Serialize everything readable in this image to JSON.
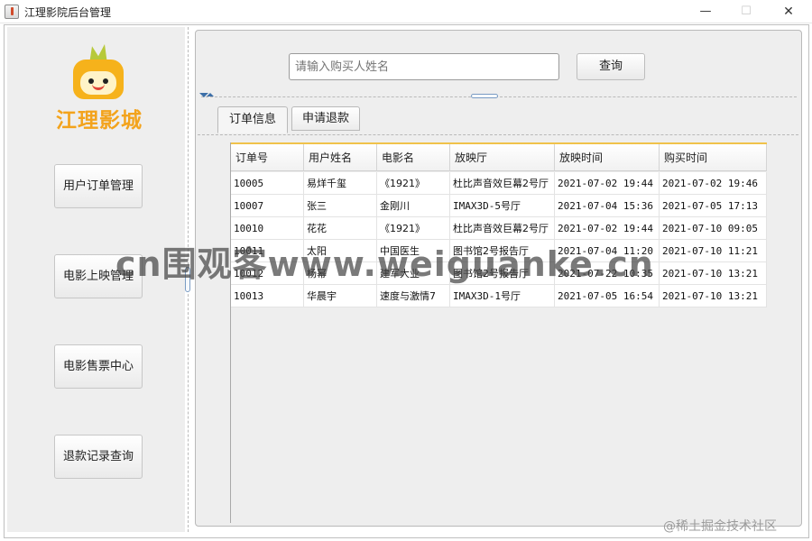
{
  "window": {
    "title": "江理影院后台管理",
    "minimize": "—",
    "maximize": "☐",
    "close": "✕"
  },
  "sidebar": {
    "logo_text": "江理影城",
    "buttons": [
      {
        "label": "用户订单管理"
      },
      {
        "label": "电影上映管理"
      },
      {
        "label": "电影售票中心"
      },
      {
        "label": "退款记录查询"
      }
    ]
  },
  "search": {
    "placeholder": "请输入购买人姓名",
    "button_label": "查询"
  },
  "tabs": [
    {
      "label": "订单信息",
      "active": true
    },
    {
      "label": "申请退款",
      "active": false
    }
  ],
  "table": {
    "columns": [
      "订单号",
      "用户姓名",
      "电影名",
      "放映厅",
      "放映时间",
      "购买时间"
    ],
    "rows": [
      [
        "10005",
        "易烊千玺",
        "《1921》",
        "杜比声音效巨幕2号厅",
        "2021-07-02 19:44",
        "2021-07-02 19:46"
      ],
      [
        "10007",
        "张三",
        "金刚川",
        "IMAX3D-5号厅",
        "2021-07-04 15:36",
        "2021-07-05 17:13"
      ],
      [
        "10010",
        "花花",
        "《1921》",
        "杜比声音效巨幕2号厅",
        "2021-07-02 19:44",
        "2021-07-10 09:05"
      ],
      [
        "10011",
        "太阳",
        "中国医生",
        "图书馆2号报告厅",
        "2021-07-04 11:20",
        "2021-07-10 11:21"
      ],
      [
        "10012",
        "杨幂",
        "建军大业",
        "图书馆2号报告厅",
        "2021-07-22 10:35",
        "2021-07-10 13:21"
      ],
      [
        "10013",
        "华晨宇",
        "速度与激情7",
        "IMAX3D-1号厅",
        "2021-07-05 16:54",
        "2021-07-10 13:21"
      ]
    ]
  },
  "overlay": {
    "watermark": "cn围观客www.weiguanke.cn",
    "corner_text": "@稀土掘金技术社区"
  }
}
